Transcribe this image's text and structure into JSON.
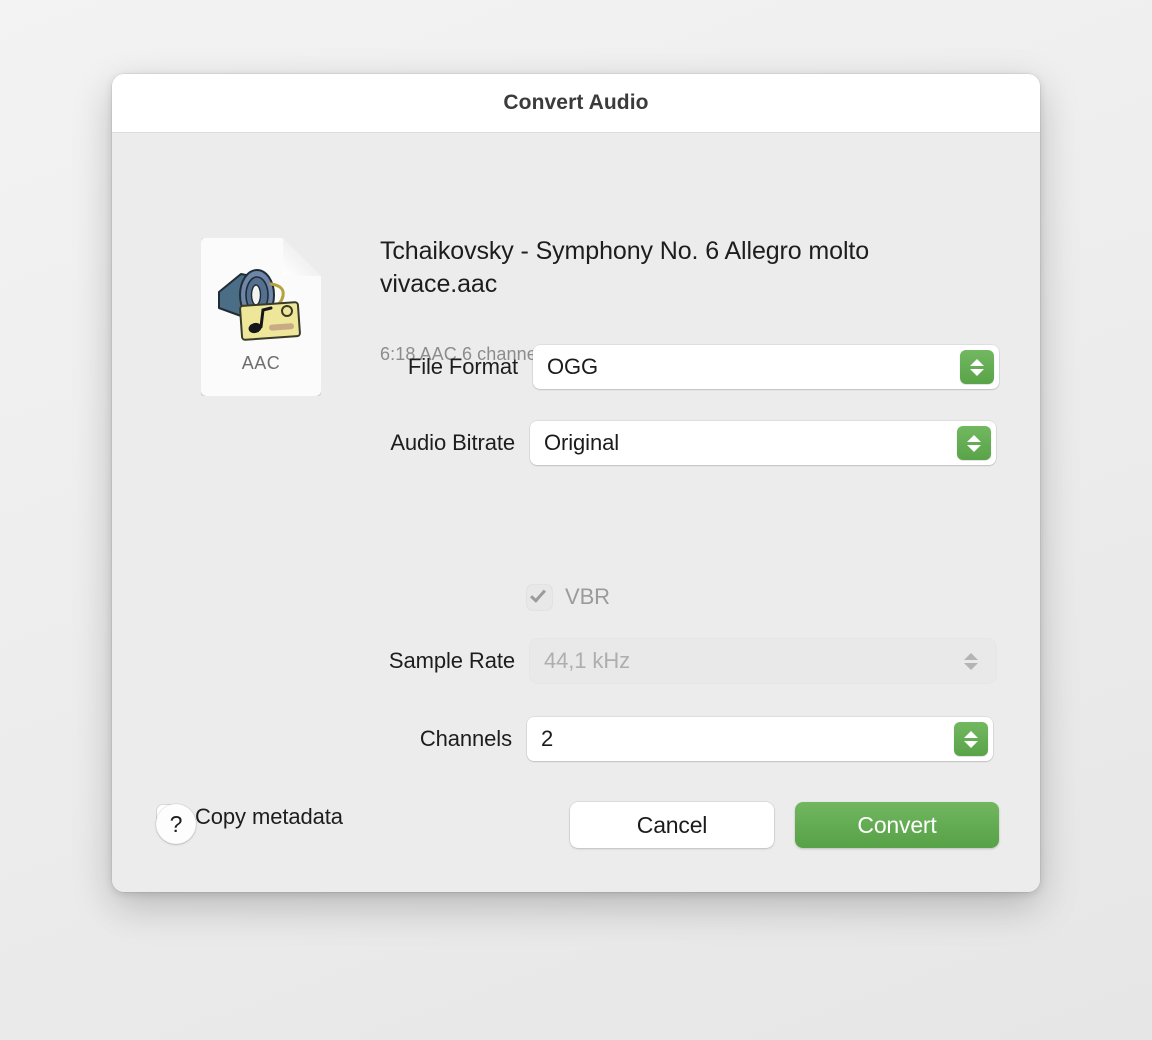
{
  "window": {
    "title": "Convert Audio"
  },
  "file": {
    "icon_label": "AAC",
    "icon_name": "aac-audio-file-icon",
    "name": "Tchaikovsky - Symphony No. 6 Allegro molto vivace.aac",
    "meta": "6:18  AAC 6 channels"
  },
  "form": {
    "file_format": {
      "label": "File Format",
      "value": "OGG"
    },
    "audio_bitrate": {
      "label": "Audio Bitrate",
      "value": "Original"
    },
    "vbr": {
      "label": "VBR",
      "checked": "true",
      "enabled": "false"
    },
    "sample_rate": {
      "label": "Sample Rate",
      "value": "44,1 kHz",
      "enabled": "false"
    },
    "channels": {
      "label": "Channels",
      "value": "2"
    },
    "copy_metadata": {
      "label": "Copy metadata",
      "checked": "false"
    }
  },
  "footer": {
    "help_label": "?",
    "cancel_label": "Cancel",
    "convert_label": "Convert"
  },
  "colors": {
    "accent_green": "#5BA84D",
    "window_body": "#ECECEC",
    "titlebar": "#FFFFFF",
    "label_text": "#1D1D1D",
    "muted_text": "#8C8C8C"
  }
}
